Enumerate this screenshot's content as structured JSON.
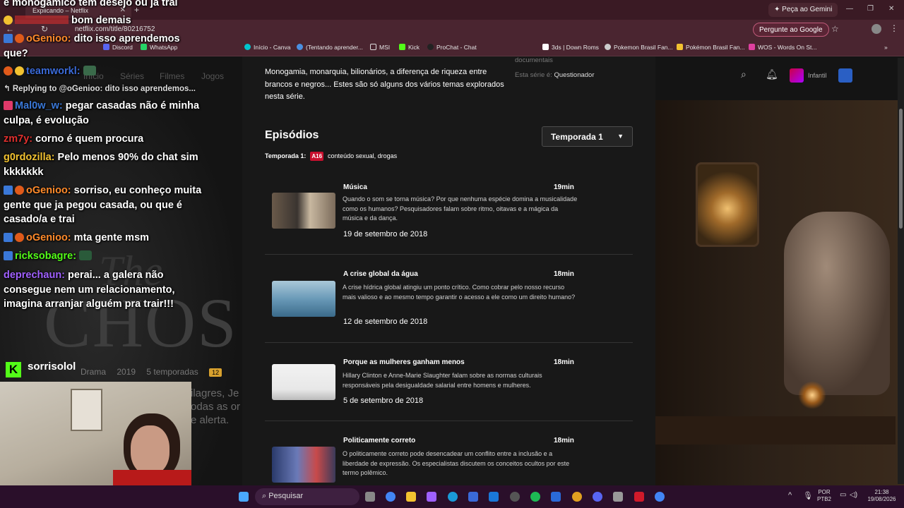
{
  "browser": {
    "tab_title": "Explicando – Netflix",
    "url": "netflix.com/title/80216752",
    "gemini_top": "Peça ao Gemini",
    "gemini_button": "Pergunte ao Google"
  },
  "bookmarks": [
    {
      "label": "Discord"
    },
    {
      "label": "WhatsApp"
    },
    {
      "label": "Início - Canva"
    },
    {
      "label": "(Tentando aprender..."
    },
    {
      "label": "MSI"
    },
    {
      "label": "Kick"
    },
    {
      "label": "ProChat - Chat"
    },
    {
      "label": "3ds | Down Roms"
    },
    {
      "label": "Pokemon Brasil Fan..."
    },
    {
      "label": "Pokémon Brasil Fan..."
    },
    {
      "label": "WOS - Words On St..."
    }
  ],
  "netflix": {
    "nav": [
      "Início",
      "Séries",
      "Filmes",
      "Jogos"
    ],
    "profile_label": "Infantil",
    "left_meta": {
      "genre": "Drama",
      "year": "2019",
      "seasons": "5 temporadas",
      "rating": "12"
    },
    "left_desc": [
      "ilagres, Je",
      "odas as or",
      "e alerta."
    ],
    "show_desc": "Monogamia, monarquia, bilionários, a diferença de riqueza entre brancos e negros... Estes são só alguns dos vários temas explorados nesta série.",
    "side_meta_top": "documentais",
    "side_meta_label": "Esta série é:",
    "side_meta_value": "Questionador",
    "episodes_title": "Episódios",
    "season_select": "Temporada 1",
    "season_label": "Temporada 1:",
    "season_rating": "A16",
    "season_content": "conteúdo sexual, drogas",
    "episodes": [
      {
        "title": "Música",
        "duration": "19min",
        "synopsis": "Quando o som se torna música? Por que nenhuma espécie domina a musicalidade como os humanos? Pesquisadores falam sobre ritmo, oitavas e a mágica da música e da dança.",
        "date": "19 de setembro de 2018"
      },
      {
        "title": "A crise global da água",
        "duration": "18min",
        "synopsis": "A crise hídrica global atingiu um ponto crítico. Como cobrar pelo nosso recurso mais valioso e ao mesmo tempo garantir o acesso a ele como um direito humano?",
        "date": "12 de setembro de 2018"
      },
      {
        "title": "Porque as mulheres ganham menos",
        "duration": "18min",
        "synopsis": "Hillary Clinton e Anne-Marie Slaughter falam sobre as normas culturais responsáveis pela desigualdade salarial entre homens e mulheres.",
        "date": "5 de setembro de 2018"
      },
      {
        "title": "Politicamente correto",
        "duration": "18min",
        "synopsis": "O politicamente correto pode desencadear um conflito entre a inclusão e a liberdade de expressão. Os especialistas discutem os conceitos ocultos por este termo polêmico.",
        "date": ""
      }
    ]
  },
  "chat": {
    "top_line": "e monogamico tem desejo ou ja trai",
    "messages": [
      {
        "user": "",
        "text": "bom demais",
        "color": "#e0302e"
      },
      {
        "user": "oGenioo:",
        "text": "dito isso aprendemos que?",
        "color": "#ff8a2a"
      },
      {
        "user": "teamworkl:",
        "text": "",
        "color": "#3a6ad8"
      },
      {
        "reply": "Replying to @oGenioo: dito isso aprendemos..."
      },
      {
        "user": "Mal0w_w:",
        "text": "pegar casadas não é minha culpa, é evolução",
        "color": "#3a78d8"
      },
      {
        "user": "zm7y:",
        "text": "corno é quem procura",
        "color": "#e0302e"
      },
      {
        "user": "g0rdozilla:",
        "text": "Pelo menos 90% do chat sim kkkkkkk",
        "color": "#f2c230"
      },
      {
        "user": "oGenioo:",
        "text": "sorriso, eu conheço muita gente que ja pegou casada, ou que é casado/a e trai",
        "color": "#ff8a2a"
      },
      {
        "user": "oGenioo:",
        "text": "mta gente msm",
        "color": "#ff8a2a"
      },
      {
        "user": "ricksobagre:",
        "text": "",
        "color": "#53fc18"
      },
      {
        "user": "deprechaun:",
        "text": "perai... a galera não consegue nem um relacionamento, imagina arranjar alguém pra trair!!!",
        "color": "#a060ff"
      }
    ],
    "streamer": "sorrisolol"
  },
  "taskbar": {
    "search": "Pesquisar",
    "lang": "POR",
    "layout": "PTB2",
    "time": "21:38",
    "date": "19/08/2026"
  }
}
